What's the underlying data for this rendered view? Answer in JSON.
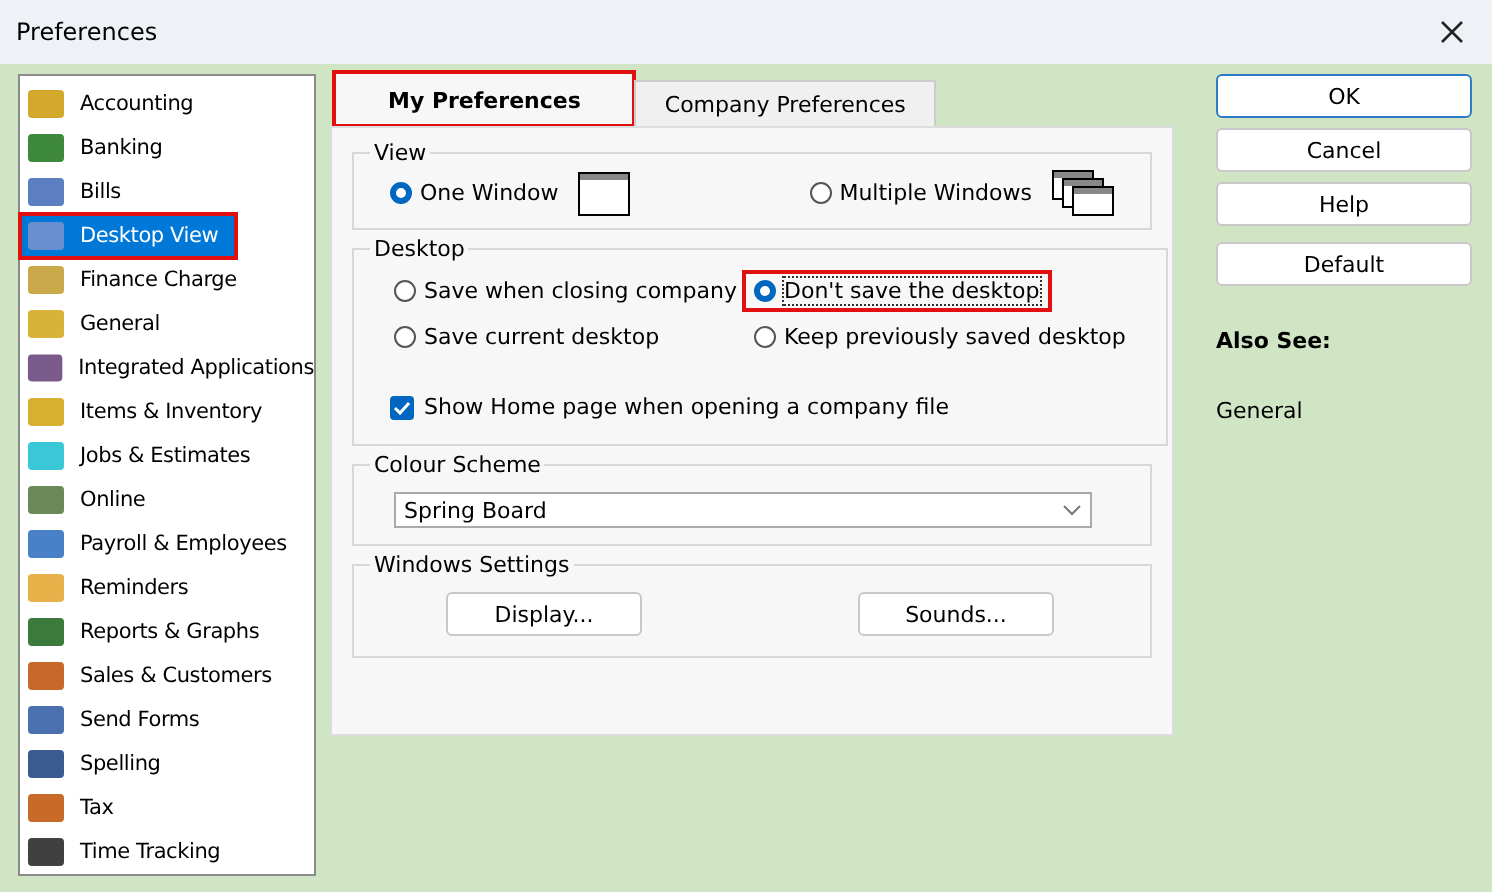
{
  "window": {
    "title": "Preferences"
  },
  "sidebar": {
    "items": [
      {
        "label": "Accounting",
        "selected": false,
        "highlighted": false,
        "color": "#d4a82a"
      },
      {
        "label": "Banking",
        "selected": false,
        "highlighted": false,
        "color": "#3f8a3a"
      },
      {
        "label": "Bills",
        "selected": false,
        "highlighted": false,
        "color": "#5b7fc0"
      },
      {
        "label": "Desktop View",
        "selected": true,
        "highlighted": true,
        "color": "#6a8fd0"
      },
      {
        "label": "Finance Charge",
        "selected": false,
        "highlighted": false,
        "color": "#c9a94a"
      },
      {
        "label": "General",
        "selected": false,
        "highlighted": false,
        "color": "#d9b23a"
      },
      {
        "label": "Integrated Applications",
        "selected": false,
        "highlighted": false,
        "color": "#7a5a8a"
      },
      {
        "label": "Items & Inventory",
        "selected": false,
        "highlighted": false,
        "color": "#d8b030"
      },
      {
        "label": "Jobs & Estimates",
        "selected": false,
        "highlighted": false,
        "color": "#3ac8d8"
      },
      {
        "label": "Online",
        "selected": false,
        "highlighted": false,
        "color": "#6a8a5a"
      },
      {
        "label": "Payroll & Employees",
        "selected": false,
        "highlighted": false,
        "color": "#4a80c8"
      },
      {
        "label": "Reminders",
        "selected": false,
        "highlighted": false,
        "color": "#e8b048"
      },
      {
        "label": "Reports & Graphs",
        "selected": false,
        "highlighted": false,
        "color": "#3a7a3a"
      },
      {
        "label": "Sales & Customers",
        "selected": false,
        "highlighted": false,
        "color": "#c8682a"
      },
      {
        "label": "Send Forms",
        "selected": false,
        "highlighted": false,
        "color": "#4a70b0"
      },
      {
        "label": "Spelling",
        "selected": false,
        "highlighted": false,
        "color": "#3a5a90"
      },
      {
        "label": "Tax",
        "selected": false,
        "highlighted": false,
        "color": "#c86a2a"
      },
      {
        "label": "Time Tracking",
        "selected": false,
        "highlighted": false,
        "color": "#404040"
      }
    ]
  },
  "tabs": [
    {
      "label": "My Preferences",
      "selected": true,
      "highlighted": true
    },
    {
      "label": "Company Preferences",
      "selected": false,
      "highlighted": false
    }
  ],
  "view": {
    "title": "View",
    "options": [
      {
        "label": "One Window",
        "selected": true,
        "kind": "single"
      },
      {
        "label": "Multiple Windows",
        "selected": false,
        "kind": "multiple"
      }
    ]
  },
  "desktop": {
    "title": "Desktop",
    "options": [
      {
        "label": "Save when closing company",
        "selected": false,
        "highlighted": false
      },
      {
        "label": "Don't save the desktop",
        "selected": true,
        "highlighted": true
      },
      {
        "label": "Save current desktop",
        "selected": false,
        "highlighted": false
      },
      {
        "label": "Keep previously saved desktop",
        "selected": false,
        "highlighted": false
      }
    ],
    "checkbox": {
      "label": "Show Home page when opening a company file",
      "checked": true
    }
  },
  "colour_scheme": {
    "title": "Colour Scheme",
    "value": "Spring Board"
  },
  "windows_settings": {
    "title": "Windows Settings",
    "buttons": [
      "Display...",
      "Sounds..."
    ]
  },
  "buttons": [
    {
      "label": "OK",
      "default": true
    },
    {
      "label": "Cancel",
      "default": false
    },
    {
      "label": "Help",
      "default": false
    },
    {
      "label": "Default",
      "default": false
    }
  ],
  "also_see": {
    "title": "Also See:",
    "links": [
      "General"
    ]
  }
}
